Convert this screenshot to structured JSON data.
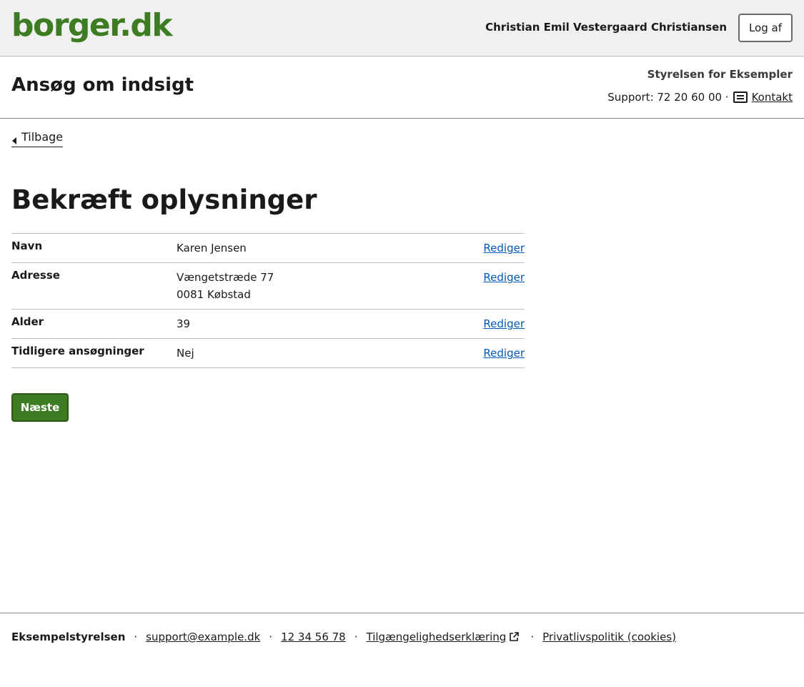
{
  "header": {
    "logo_text": "borger.dk",
    "user_name": "Christian Emil Vestergaard Christiansen",
    "logout_label": "Log af"
  },
  "service": {
    "title": "Ansøg om indsigt",
    "authority": "Styrelsen for Eksempler",
    "support_text": "Support: 72 20 60 00 ·",
    "contact_label": "Kontakt"
  },
  "nav": {
    "back_label": "Tilbage"
  },
  "main": {
    "title": "Bekræft oplysninger",
    "rows": [
      {
        "label": "Navn",
        "value_lines": [
          "Karen Jensen"
        ],
        "edit_label": "Rediger"
      },
      {
        "label": "Adresse",
        "value_lines": [
          "Vængetstræde 77",
          "0081 Købstad"
        ],
        "edit_label": "Rediger"
      },
      {
        "label": "Alder",
        "value_lines": [
          "39"
        ],
        "edit_label": "Rediger"
      },
      {
        "label": "Tidligere ansøgninger",
        "value_lines": [
          "Nej"
        ],
        "edit_label": "Rediger"
      }
    ],
    "next_label": "Næste"
  },
  "footer": {
    "org": "Eksempelstyrelsen",
    "separator": "·",
    "email": "support@example.dk",
    "phone": "12 34 56 78",
    "accessibility": "Tilgængelighedserklæring",
    "privacy": "Privatlivspolitik (cookies)"
  },
  "colors": {
    "brand_green": "#3d7c22",
    "link_blue": "#0059b3",
    "header_bg": "#f0f0f0"
  },
  "icons": {
    "contact": "message-icon",
    "back": "caret-left-icon",
    "external": "external-link-icon"
  }
}
